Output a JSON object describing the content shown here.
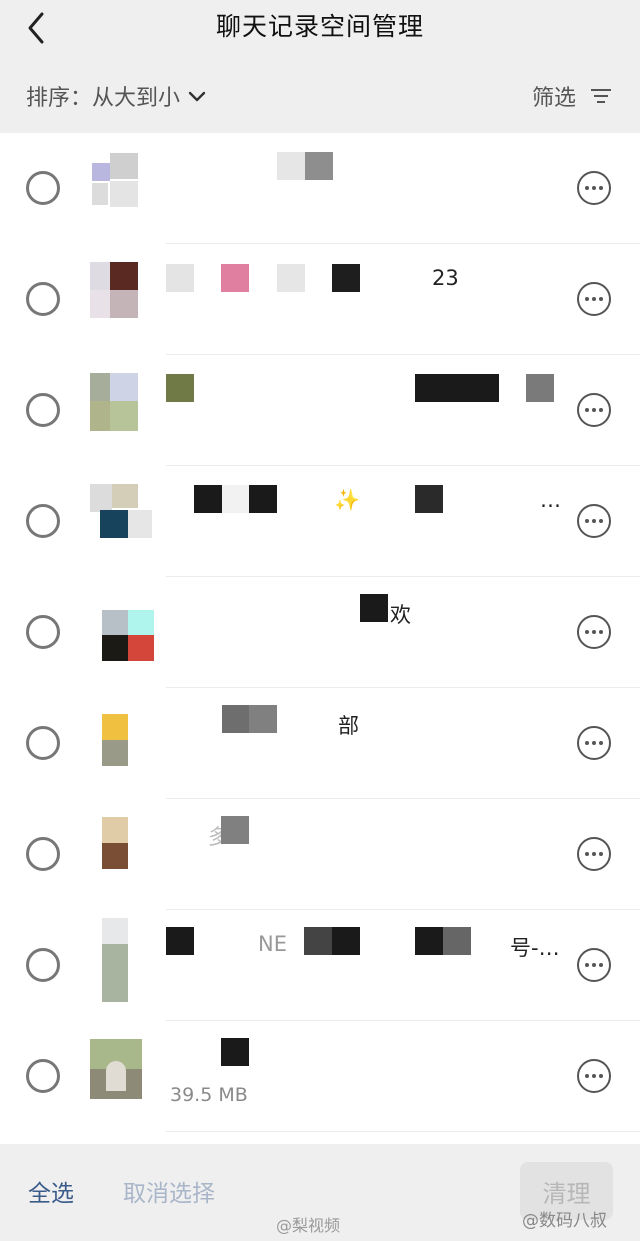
{
  "header": {
    "title": "聊天记录空间管理",
    "back_icon": "chevron-left-icon"
  },
  "toolbar": {
    "sort_label": "排序：从大到小",
    "filter_label": "筛选",
    "sort_icon": "chevron-down-icon",
    "filter_icon": "filter-lines-icon"
  },
  "rows": [
    {
      "text": "",
      "size": ""
    },
    {
      "text": "23",
      "size": ""
    },
    {
      "text": "",
      "size": ""
    },
    {
      "text": "✨",
      "text2": "…",
      "size": ""
    },
    {
      "text": "欢",
      "size": ""
    },
    {
      "text": "部",
      "size": ""
    },
    {
      "text": "多",
      "size": ""
    },
    {
      "text": "NE",
      "text2": "号-…",
      "size": ""
    },
    {
      "text": "",
      "size": "39.5 MB"
    }
  ],
  "footer": {
    "select_all": "全选",
    "deselect": "取消选择",
    "clean": "清理"
  },
  "watermarks": {
    "left": "@梨视频",
    "right": "@数码八叔"
  },
  "colors": {
    "accent": "#3b5b8a",
    "disabled": "#a9b6c9",
    "bar_bg": "#efefef"
  }
}
